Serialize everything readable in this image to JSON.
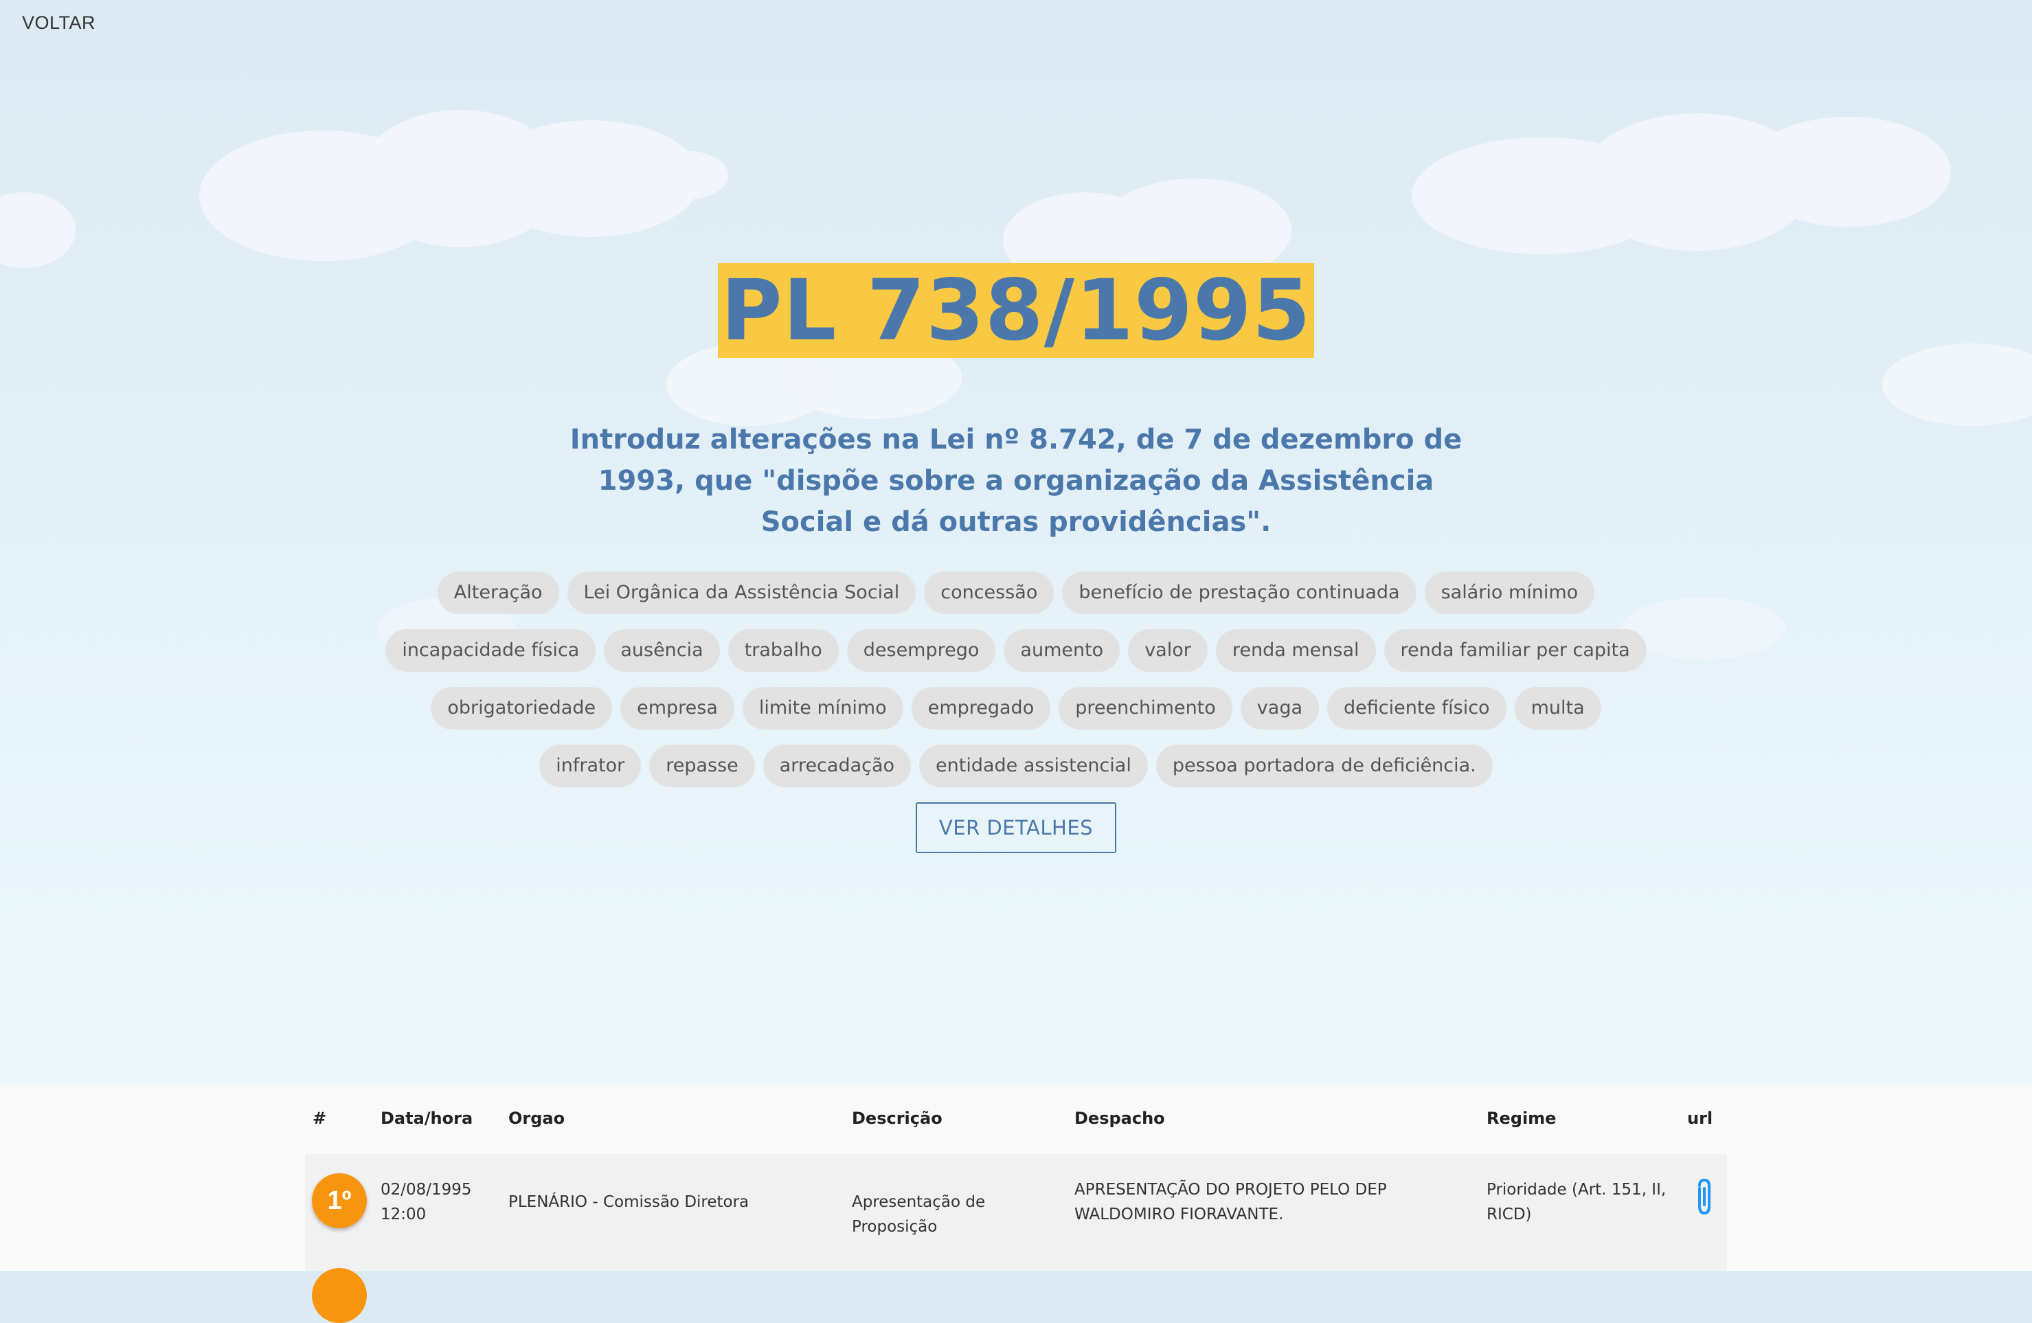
{
  "nav": {
    "back_label": "VOLTAR"
  },
  "header": {
    "title": "PL 738/1995",
    "ementa": "Introduz alterações na Lei nº 8.742, de 7 de dezembro de 1993, que \"dispõe sobre a organização da Assistência Social e dá outras providências\".",
    "details_button": "VER DETALHES"
  },
  "tags": [
    "Alteração",
    "Lei Orgânica da Assistência Social",
    "concessão",
    "benefício de prestação continuada",
    "salário mínimo",
    "incapacidade física",
    "ausência",
    "trabalho",
    "desemprego",
    "aumento",
    "valor",
    "renda mensal",
    "renda familiar per capita",
    "obrigatoriedade",
    "empresa",
    "limite mínimo",
    "empregado",
    "preenchimento",
    "vaga",
    "deficiente físico",
    "multa",
    "infrator",
    "repasse",
    "arrecadação",
    "entidade assistencial",
    "pessoa portadora de deficiência."
  ],
  "table": {
    "headers": {
      "num": "#",
      "datahora": "Data/hora",
      "orgao": "Orgao",
      "descricao": "Descrição",
      "despacho": "Despacho",
      "regime": "Regime",
      "url": "url"
    },
    "rows": [
      {
        "num": "1º",
        "date": "02/08/1995",
        "time": "12:00",
        "orgao": "PLENÁRIO - Comissão Diretora",
        "descricao": "Apresentação de Proposição",
        "despacho": "APRESENTAÇÃO DO PROJETO PELO DEP WALDOMIRO FIORAVANTE.",
        "regime": "Prioridade (Art. 151, II, RICD)",
        "url_icon": "paperclip-icon"
      }
    ]
  },
  "colors": {
    "accent_title_bg": "#fac944",
    "primary_text": "#4b78ab",
    "badge": "#f7960e",
    "tag_bg": "#e2e2e2",
    "link_icon": "#2196f3"
  }
}
